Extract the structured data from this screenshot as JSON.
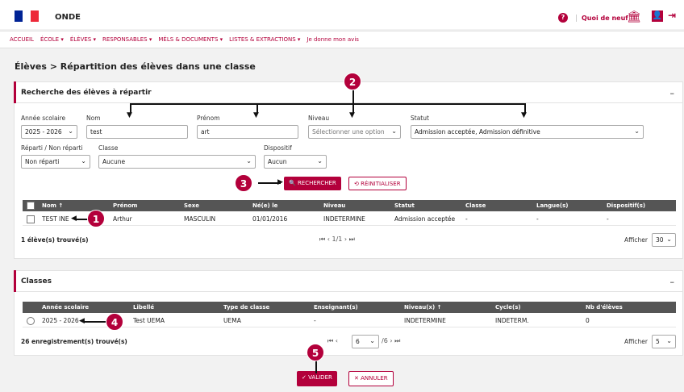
{
  "header": {
    "app_title": "ONDE",
    "help_icon": "?",
    "whats_new": "Quoi de neuf",
    "institution_icon": "bank-icon",
    "user_icon": "user-icon",
    "logout_icon": "logout-icon"
  },
  "menu": [
    "ACCUEIL",
    "ÉCOLE ▾",
    "ÉLÈVES ▾",
    "RESPONSABLES ▾",
    "MÉLS & DOCUMENTS ▾",
    "LISTES & EXTRACTIONS ▾",
    "Je donne mon avis"
  ],
  "breadcrumb": "Élèves > Répartition des élèves dans une classe",
  "search_panel": {
    "title": "Recherche des élèves à répartir",
    "collapse": "–",
    "labels": {
      "year": "Année scolaire",
      "name": "Nom",
      "firstname": "Prénom",
      "level": "Niveau",
      "status": "Statut",
      "assigned": "Réparti / Non réparti",
      "class": "Classe",
      "device": "Dispositif"
    },
    "values": {
      "year": "2025 - 2026",
      "name": "test",
      "firstname": "art",
      "level": "Sélectionner une option",
      "status": "Admission acceptée, Admission définitive",
      "assigned": "Non réparti",
      "class": "Aucune",
      "device": "Aucun"
    },
    "search_button": "🔍 RECHERCHER",
    "reset_button": "⟲ RÉINITIALISER"
  },
  "students_table": {
    "headers": [
      "Nom ↑",
      "Prénom",
      "Sexe",
      "Né(e) le",
      "Niveau",
      "Statut",
      "Classe",
      "Langue(s)",
      "Dispositif(s)"
    ],
    "rows": [
      [
        "TEST INE",
        "Arthur",
        "MASCULIN",
        "01/01/2016",
        "INDETERMINE",
        "Admission acceptée",
        "-",
        "-",
        "-"
      ]
    ],
    "count": "1 élève(s) trouvé(s)",
    "pager": "⏮  ‹  1/1  ›  ⏭",
    "show_label": "Afficher",
    "show_value": "30"
  },
  "classes_panel": {
    "title": "Classes",
    "collapse": "–",
    "headers": [
      "Année scolaire",
      "Libellé",
      "Type de classe",
      "Enseignant(s)",
      "Niveau(x) ↑",
      "Cycle(s)",
      "Nb d'élèves"
    ],
    "rows": [
      [
        "2025 - 2026",
        "Test UEMA",
        "UEMA",
        "-",
        "INDETERMINE",
        "INDETERM.",
        "0"
      ]
    ],
    "count": "26 enregistrement(s) trouvé(s)",
    "pager_first": "⏮ ‹",
    "page_value": "6",
    "pager_total": "/6  ›  ⏭",
    "show_label": "Afficher",
    "show_value": "5"
  },
  "footer": {
    "validate_button": "✓ VALIDER",
    "cancel_button": "✕ ANNULER"
  },
  "annotations": [
    "1",
    "2",
    "3",
    "4",
    "5"
  ],
  "colors": {
    "accent": "#b3003b",
    "table_header": "#555555"
  }
}
